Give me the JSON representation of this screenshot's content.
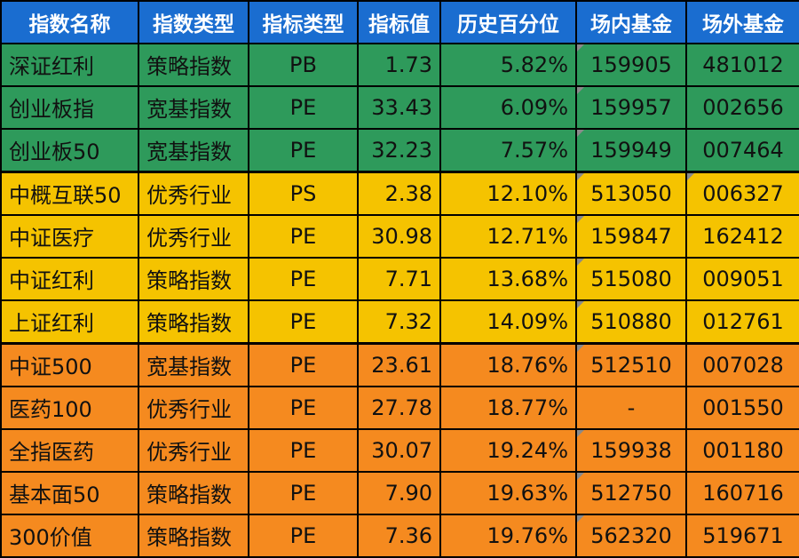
{
  "headers": [
    "指数名称",
    "指数类型",
    "指标类型",
    "指标值",
    "历史百分位",
    "场内基金",
    "场外基金"
  ],
  "rows": [
    {
      "name": "深证红利",
      "category": "策略指数",
      "metric": "PB",
      "value": "1.73",
      "percentile": "5.82%",
      "onsite_fund": "159905",
      "offsite_fund": "481012",
      "group": "green",
      "color": "#2e9a5b"
    },
    {
      "name": "创业板指",
      "category": "宽基指数",
      "metric": "PE",
      "value": "33.43",
      "percentile": "6.09%",
      "onsite_fund": "159957",
      "offsite_fund": "002656",
      "group": "green",
      "color": "#2e9a5b"
    },
    {
      "name": "创业板50",
      "category": "宽基指数",
      "metric": "PE",
      "value": "32.23",
      "percentile": "7.57%",
      "onsite_fund": "159949",
      "offsite_fund": "007464",
      "group": "green",
      "color": "#2e9a5b"
    },
    {
      "name": "中概互联50",
      "category": "优秀行业",
      "metric": "PS",
      "value": "2.38",
      "percentile": "12.10%",
      "onsite_fund": "513050",
      "offsite_fund": "006327",
      "group": "yellow",
      "color": "#f5c300"
    },
    {
      "name": "中证医疗",
      "category": "优秀行业",
      "metric": "PE",
      "value": "30.98",
      "percentile": "12.71%",
      "onsite_fund": "159847",
      "offsite_fund": "162412",
      "group": "yellow",
      "color": "#f5c300"
    },
    {
      "name": "中证红利",
      "category": "策略指数",
      "metric": "PE",
      "value": "7.71",
      "percentile": "13.68%",
      "onsite_fund": "515080",
      "offsite_fund": "009051",
      "group": "yellow",
      "color": "#f5c300"
    },
    {
      "name": "上证红利",
      "category": "策略指数",
      "metric": "PE",
      "value": "7.32",
      "percentile": "14.09%",
      "onsite_fund": "510880",
      "offsite_fund": "012761",
      "group": "yellow",
      "color": "#f5c300"
    },
    {
      "name": "中证500",
      "category": "宽基指数",
      "metric": "PE",
      "value": "23.61",
      "percentile": "18.76%",
      "onsite_fund": "512510",
      "offsite_fund": "007028",
      "group": "orange",
      "color": "#f58a1f"
    },
    {
      "name": "医药100",
      "category": "优秀行业",
      "metric": "PE",
      "value": "27.78",
      "percentile": "18.77%",
      "onsite_fund": "-",
      "offsite_fund": "001550",
      "group": "orange",
      "color": "#f58a1f"
    },
    {
      "name": "全指医药",
      "category": "优秀行业",
      "metric": "PE",
      "value": "30.07",
      "percentile": "19.24%",
      "onsite_fund": "159938",
      "offsite_fund": "001180",
      "group": "orange",
      "color": "#f58a1f"
    },
    {
      "name": "基本面50",
      "category": "策略指数",
      "metric": "PE",
      "value": "7.90",
      "percentile": "19.63%",
      "onsite_fund": "512750",
      "offsite_fund": "160716",
      "group": "orange",
      "color": "#f58a1f"
    },
    {
      "name": "300价值",
      "category": "策略指数",
      "metric": "PE",
      "value": "7.36",
      "percentile": "19.76%",
      "onsite_fund": "562320",
      "offsite_fund": "519671",
      "group": "orange",
      "color": "#f58a1f"
    }
  ],
  "colors": {
    "header_bg": "#1a6dd0",
    "header_text": "#ffffff",
    "green": "#2e9a5b",
    "yellow": "#f5c300",
    "orange": "#f58a1f",
    "border": "#000000",
    "comment_marker": "#8a8a8a"
  }
}
